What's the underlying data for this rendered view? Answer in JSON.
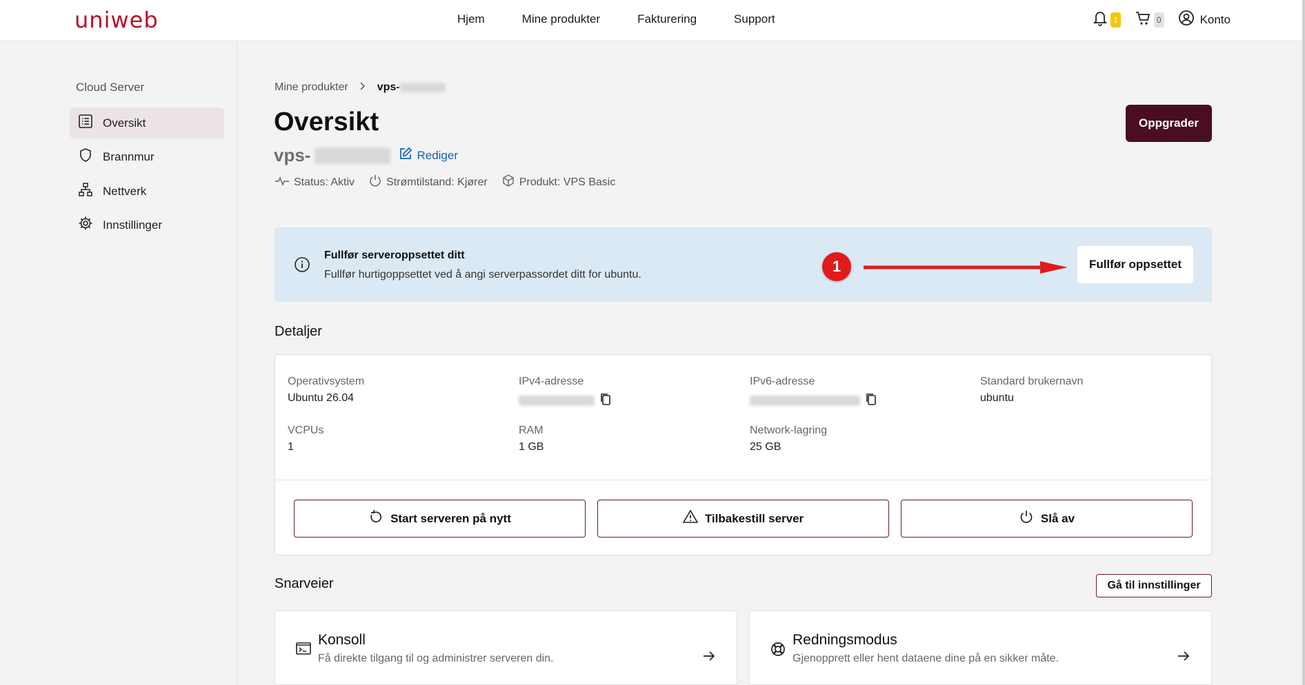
{
  "brand": {
    "logo_text": "uniweb",
    "accent_color": "#b3122b",
    "primary_button_color": "#4a0d22"
  },
  "topnav": {
    "links": [
      "Hjem",
      "Mine produkter",
      "Fakturering",
      "Support"
    ],
    "notifications_count": "1",
    "cart_count": "0",
    "account_label": "Konto"
  },
  "sidebar": {
    "title": "Cloud Server",
    "items": [
      {
        "label": "Oversikt",
        "icon": "list-icon",
        "active": true
      },
      {
        "label": "Brannmur",
        "icon": "shield-icon",
        "active": false
      },
      {
        "label": "Nettverk",
        "icon": "network-icon",
        "active": false
      },
      {
        "label": "Innstillinger",
        "icon": "gear-icon",
        "active": false
      }
    ]
  },
  "breadcrumb": {
    "parent": "Mine produkter",
    "current_prefix": "vps-"
  },
  "page": {
    "title": "Oversikt",
    "server_prefix": "vps-",
    "edit_label": "Rediger",
    "status": "Status: Aktiv",
    "power_state": "Strømtilstand: Kjører",
    "product": "Produkt: VPS Basic",
    "upgrade_button": "Oppgrader"
  },
  "banner": {
    "title": "Fullfør serveroppsettet ditt",
    "text": "Fullfør hurtigoppsettet ved å angi serverpassordet ditt for ubuntu.",
    "button": "Fullfør oppsettet",
    "step_number": "1"
  },
  "details": {
    "title": "Detaljer",
    "fields": {
      "os_label": "Operativsystem",
      "os_value": "Ubuntu 26.04",
      "ipv4_label": "IPv4-adresse",
      "ipv6_label": "IPv6-adresse",
      "user_label": "Standard brukernavn",
      "user_value": "ubuntu",
      "vcpu_label": "VCPUs",
      "vcpu_value": "1",
      "ram_label": "RAM",
      "ram_value": "1 GB",
      "storage_label": "Network-lagring",
      "storage_value": "25 GB"
    },
    "actions": [
      "Start serveren på nytt",
      "Tilbakestill server",
      "Slå av"
    ]
  },
  "shortcuts": {
    "title": "Snarveier",
    "settings_button": "Gå til innstillinger",
    "cards": [
      {
        "title": "Konsoll",
        "desc": "Få direkte tilgang til og administrer serveren din.",
        "icon": "terminal-icon"
      },
      {
        "title": "Redningsmodus",
        "desc": "Gjenopprett eller hent dataene dine på en sikker måte.",
        "icon": "lifebuoy-icon"
      }
    ]
  }
}
